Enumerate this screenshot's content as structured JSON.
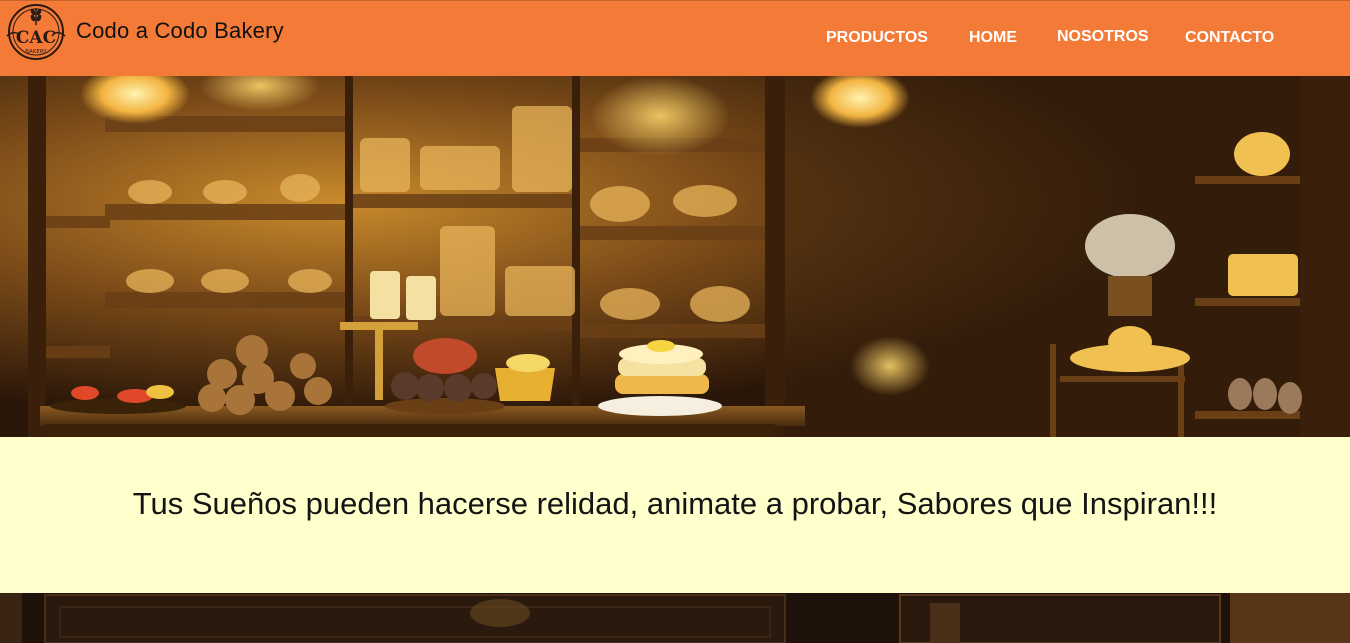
{
  "header": {
    "logo": {
      "icon": "wheat-logo-icon",
      "initials": "CAC",
      "caption": "BAKERY"
    },
    "brand_name": "Codo a Codo Bakery",
    "background_color": "#f47a38"
  },
  "nav": {
    "items": [
      {
        "label": "PRODUCTOS"
      },
      {
        "label": "HOME"
      },
      {
        "label": "NOSOTROS"
      },
      {
        "label": "CONTACTO"
      }
    ],
    "text_color": "#ffffff"
  },
  "hero": {
    "image": "bakery-shop-interior-photo"
  },
  "banner": {
    "tagline": "Tus Sueños pueden hacerse relidad, animate a probar, Sabores que Inspiran!!!",
    "background_color": "#ffffcc"
  }
}
